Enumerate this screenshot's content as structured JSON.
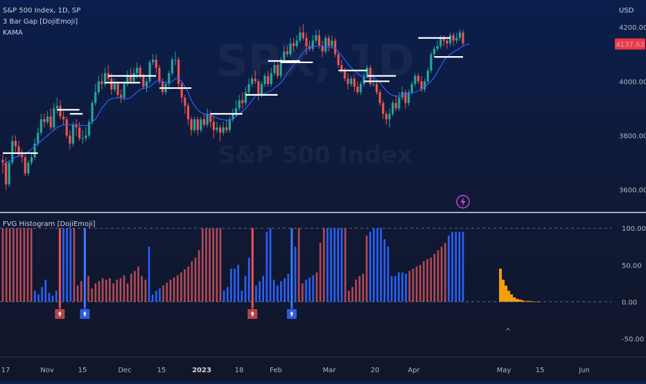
{
  "header": {
    "symbol": "S&P 500 Index, 1D, SP",
    "indicator_1": "3 Bar Gap [DojiEmoji]",
    "indicator_2": "KAMA",
    "lower_title": "FVG Histogram [DojiEmoji]",
    "currency": "USD"
  },
  "watermark": {
    "line1": "SPX, 1D",
    "line2": "S&P 500 Index"
  },
  "colors": {
    "bull": "#26a69a",
    "bear": "#ef5350",
    "kama": "#2962ff",
    "gap_line": "#ffffff",
    "hist_blue": "#2962ff",
    "hist_red": "#b54a55",
    "hist_orange": "#f59e0b",
    "price_label": "#f23645",
    "divider": "#e0e3eb",
    "lightning": "#c04de0"
  },
  "chart_data": [
    {
      "type": "candlestick",
      "title": "S&P 500 Index, 1D, SP",
      "x_ticks": [
        "17",
        "Nov",
        "15",
        "Dec",
        "15",
        "2023",
        "18",
        "Feb",
        "Mar",
        "20",
        "Apr",
        "May",
        "15",
        "Jun"
      ],
      "y_ticks": [
        "4200.00",
        "4000.00",
        "3800.00",
        "3600.00"
      ],
      "ylim": [
        3520,
        4300
      ],
      "last_price": "4137.63",
      "candles": [
        [
          3710,
          3700,
          3730,
          3660
        ],
        [
          3700,
          3620,
          3720,
          3600
        ],
        [
          3620,
          3700,
          3710,
          3610
        ],
        [
          3700,
          3780,
          3800,
          3690
        ],
        [
          3780,
          3760,
          3800,
          3740
        ],
        [
          3760,
          3730,
          3780,
          3720
        ],
        [
          3730,
          3720,
          3750,
          3700
        ],
        [
          3720,
          3660,
          3730,
          3650
        ],
        [
          3660,
          3700,
          3710,
          3650
        ],
        [
          3700,
          3720,
          3740,
          3690
        ],
        [
          3720,
          3770,
          3790,
          3710
        ],
        [
          3770,
          3810,
          3830,
          3760
        ],
        [
          3810,
          3860,
          3880,
          3800
        ],
        [
          3860,
          3850,
          3880,
          3830
        ],
        [
          3850,
          3870,
          3890,
          3840
        ],
        [
          3870,
          3830,
          3900,
          3820
        ],
        [
          3830,
          3900,
          3920,
          3820
        ],
        [
          3900,
          3910,
          3940,
          3880
        ],
        [
          3910,
          3870,
          3930,
          3860
        ],
        [
          3870,
          3860,
          3890,
          3840
        ],
        [
          3860,
          3800,
          3870,
          3790
        ],
        [
          3800,
          3770,
          3820,
          3750
        ],
        [
          3770,
          3840,
          3850,
          3760
        ],
        [
          3840,
          3830,
          3860,
          3800
        ],
        [
          3830,
          3790,
          3850,
          3780
        ],
        [
          3790,
          3790,
          3820,
          3770
        ],
        [
          3790,
          3800,
          3830,
          3780
        ],
        [
          3800,
          3850,
          3860,
          3790
        ],
        [
          3850,
          3920,
          3930,
          3840
        ],
        [
          3920,
          3960,
          3990,
          3910
        ],
        [
          3960,
          4000,
          4020,
          3950
        ],
        [
          4000,
          3990,
          4030,
          3970
        ],
        [
          3990,
          4030,
          4050,
          3980
        ],
        [
          4030,
          4010,
          4060,
          4000
        ],
        [
          4010,
          3970,
          4030,
          3950
        ],
        [
          3970,
          3990,
          4010,
          3960
        ],
        [
          3990,
          3950,
          4000,
          3940
        ],
        [
          3950,
          3940,
          3970,
          3920
        ],
        [
          3940,
          3990,
          4000,
          3930
        ],
        [
          3990,
          4020,
          4040,
          3980
        ],
        [
          4020,
          4000,
          4050,
          3990
        ],
        [
          4000,
          4030,
          4050,
          3990
        ],
        [
          4030,
          4050,
          4070,
          4010
        ],
        [
          4050,
          4020,
          4060,
          4010
        ],
        [
          4020,
          3980,
          4030,
          3970
        ],
        [
          3980,
          4000,
          4010,
          3960
        ],
        [
          4000,
          4070,
          4080,
          3990
        ],
        [
          4070,
          4080,
          4100,
          4060
        ],
        [
          4080,
          4050,
          4100,
          4030
        ],
        [
          4050,
          4000,
          4060,
          3990
        ],
        [
          4000,
          3960,
          4010,
          3950
        ],
        [
          3960,
          3990,
          4000,
          3950
        ],
        [
          3990,
          4030,
          4040,
          3970
        ],
        [
          4030,
          4080,
          4090,
          4020
        ],
        [
          4080,
          4080,
          4110,
          4060
        ],
        [
          4080,
          3990,
          4090,
          3970
        ],
        [
          3990,
          3940,
          4000,
          3920
        ],
        [
          3940,
          3910,
          3950,
          3880
        ],
        [
          3910,
          3860,
          3920,
          3840
        ],
        [
          3860,
          3820,
          3870,
          3800
        ],
        [
          3820,
          3860,
          3870,
          3810
        ],
        [
          3860,
          3820,
          3870,
          3800
        ],
        [
          3820,
          3860,
          3870,
          3810
        ],
        [
          3860,
          3840,
          3880,
          3830
        ],
        [
          3840,
          3880,
          3900,
          3830
        ],
        [
          3880,
          3850,
          3890,
          3830
        ],
        [
          3850,
          3820,
          3870,
          3790
        ],
        [
          3820,
          3830,
          3850,
          3810
        ],
        [
          3830,
          3810,
          3840,
          3780
        ],
        [
          3810,
          3830,
          3850,
          3800
        ],
        [
          3830,
          3820,
          3860,
          3810
        ],
        [
          3820,
          3860,
          3870,
          3810
        ],
        [
          3860,
          3880,
          3900,
          3850
        ],
        [
          3880,
          3900,
          3930,
          3870
        ],
        [
          3900,
          3930,
          3950,
          3890
        ],
        [
          3930,
          3920,
          3960,
          3900
        ],
        [
          3920,
          3960,
          3980,
          3910
        ],
        [
          3960,
          3990,
          4010,
          3950
        ],
        [
          3990,
          4010,
          4020,
          3980
        ],
        [
          4010,
          4000,
          4040,
          3990
        ],
        [
          4000,
          3950,
          4010,
          3930
        ],
        [
          3950,
          3990,
          4000,
          3940
        ],
        [
          3990,
          4020,
          4030,
          3980
        ],
        [
          4020,
          3990,
          4040,
          3980
        ],
        [
          3990,
          4030,
          4050,
          3980
        ],
        [
          4030,
          4060,
          4070,
          4020
        ],
        [
          4060,
          4020,
          4070,
          4010
        ],
        [
          4020,
          4080,
          4090,
          4010
        ],
        [
          4080,
          4110,
          4130,
          4070
        ],
        [
          4110,
          4100,
          4130,
          4090
        ],
        [
          4100,
          4140,
          4160,
          4090
        ],
        [
          4140,
          4130,
          4160,
          4110
        ],
        [
          4130,
          4150,
          4170,
          4120
        ],
        [
          4150,
          4180,
          4200,
          4140
        ],
        [
          4180,
          4160,
          4210,
          4150
        ],
        [
          4160,
          4130,
          4180,
          4100
        ],
        [
          4130,
          4120,
          4150,
          4110
        ],
        [
          4120,
          4150,
          4170,
          4110
        ],
        [
          4150,
          4170,
          4190,
          4140
        ],
        [
          4170,
          4130,
          4190,
          4120
        ],
        [
          4130,
          4110,
          4150,
          4090
        ],
        [
          4110,
          4160,
          4170,
          4100
        ],
        [
          4160,
          4130,
          4170,
          4110
        ],
        [
          4130,
          4150,
          4170,
          4120
        ],
        [
          4150,
          4100,
          4160,
          4090
        ],
        [
          4100,
          4060,
          4110,
          4050
        ],
        [
          4060,
          4040,
          4080,
          4030
        ],
        [
          4040,
          4010,
          4050,
          4000
        ],
        [
          4010,
          3990,
          4030,
          3970
        ],
        [
          3990,
          4010,
          4020,
          3980
        ],
        [
          4010,
          3980,
          4020,
          3960
        ],
        [
          3980,
          3960,
          4000,
          3950
        ],
        [
          3960,
          3990,
          4000,
          3950
        ],
        [
          3990,
          4020,
          4030,
          3980
        ],
        [
          4020,
          4050,
          4060,
          4010
        ],
        [
          4050,
          3990,
          4060,
          3980
        ],
        [
          3990,
          3990,
          4010,
          3980
        ],
        [
          3990,
          3960,
          4000,
          3950
        ],
        [
          3960,
          3920,
          3970,
          3910
        ],
        [
          3920,
          3880,
          3930,
          3860
        ],
        [
          3880,
          3860,
          3890,
          3840
        ],
        [
          3860,
          3880,
          3900,
          3830
        ],
        [
          3880,
          3920,
          3930,
          3870
        ],
        [
          3920,
          3900,
          3950,
          3890
        ],
        [
          3900,
          3940,
          3960,
          3890
        ],
        [
          3940,
          3960,
          3980,
          3930
        ],
        [
          3960,
          3920,
          3970,
          3900
        ],
        [
          3920,
          3960,
          3970,
          3910
        ],
        [
          3960,
          3990,
          4000,
          3950
        ],
        [
          3990,
          4020,
          4030,
          3980
        ],
        [
          4020,
          4000,
          4030,
          3990
        ],
        [
          4000,
          3970,
          4020,
          3960
        ],
        [
          3970,
          4000,
          4010,
          3960
        ],
        [
          4000,
          4040,
          4050,
          3990
        ],
        [
          4040,
          4100,
          4110,
          4030
        ],
        [
          4100,
          4120,
          4130,
          4090
        ],
        [
          4120,
          4130,
          4150,
          4110
        ],
        [
          4130,
          4160,
          4170,
          4120
        ],
        [
          4160,
          4150,
          4170,
          4130
        ],
        [
          4150,
          4140,
          4160,
          4120
        ],
        [
          4140,
          4170,
          4180,
          4130
        ],
        [
          4170,
          4150,
          4180,
          4130
        ],
        [
          4150,
          4160,
          4180,
          4140
        ],
        [
          4160,
          4180,
          4190,
          4150
        ],
        [
          4180,
          4140,
          4190,
          4130
        ]
      ],
      "kama": [
        3690,
        3700,
        3705,
        3710,
        3720,
        3725,
        3730,
        3735,
        3740,
        3750,
        3760,
        3770,
        3780,
        3790,
        3800,
        3810,
        3820,
        3830,
        3835,
        3840,
        3840,
        3840,
        3840,
        3840,
        3838,
        3836,
        3836,
        3840,
        3850,
        3860,
        3880,
        3900,
        3915,
        3930,
        3935,
        3938,
        3940,
        3938,
        3936,
        3935,
        3940,
        3950,
        3960,
        3970,
        3975,
        3975,
        3980,
        3990,
        4000,
        4000,
        3998,
        3995,
        3995,
        4000,
        4010,
        4010,
        4000,
        3980,
        3960,
        3930,
        3910,
        3895,
        3885,
        3880,
        3878,
        3875,
        3870,
        3865,
        3860,
        3858,
        3856,
        3856,
        3860,
        3870,
        3880,
        3890,
        3900,
        3915,
        3930,
        3945,
        3950,
        3950,
        3955,
        3960,
        3965,
        3975,
        3985,
        3995,
        4010,
        4030,
        4045,
        4060,
        4075,
        4090,
        4105,
        4120,
        4125,
        4128,
        4130,
        4132,
        4130,
        4128,
        4126,
        4125,
        4122,
        4110,
        4095,
        4080,
        4065,
        4050,
        4040,
        4030,
        4020,
        4015,
        4015,
        4018,
        4015,
        4005,
        3995,
        3980,
        3965,
        3955,
        3948,
        3945,
        3945,
        3948,
        3952,
        3955,
        3958,
        3960,
        3965,
        3972,
        3980,
        3990,
        4000,
        4015,
        4035,
        4055,
        4075,
        4090,
        4100,
        4108,
        4115,
        4122,
        4130,
        4135,
        4138
      ]
    },
    {
      "type": "bar",
      "title": "FVG Histogram [DojiEmoji]",
      "y_ticks": [
        "100.00",
        "50.00",
        "0.00",
        "-50.00"
      ],
      "ylim": [
        -75,
        120
      ],
      "series": [
        {
          "values": [
            100,
            100,
            100,
            100,
            100,
            100,
            100,
            100,
            100,
            15,
            10,
            20,
            30,
            12,
            8,
            15,
            40,
            100,
            100,
            100,
            100,
            22,
            28,
            48,
            35,
            18,
            25,
            28,
            32,
            30,
            32,
            25,
            30,
            32,
            36,
            25,
            38,
            42,
            48,
            35,
            30,
            75,
            10,
            15,
            18,
            22,
            26,
            30,
            33,
            36,
            40,
            44,
            48,
            55,
            60,
            70,
            100,
            100,
            100,
            100,
            100,
            100,
            15,
            20,
            45,
            45,
            50,
            15,
            35,
            60,
            100,
            22,
            28,
            35,
            95,
            100,
            30,
            22,
            28,
            32,
            38,
            45,
            75,
            100,
            25,
            30,
            33,
            36,
            40,
            80,
            100,
            100,
            100,
            100,
            100,
            100,
            100,
            15,
            20,
            30,
            35,
            38,
            90,
            95,
            100,
            100,
            100,
            85,
            75,
            35,
            35,
            40,
            40,
            38,
            42,
            45,
            48,
            50,
            55,
            58,
            60,
            65,
            70,
            75,
            80,
            90,
            95,
            95,
            95,
            95
          ]
        },
        {
          "values": [
            45,
            30,
            22,
            15,
            10,
            6,
            4,
            3,
            2,
            1,
            1,
            1,
            0,
            0,
            0
          ]
        }
      ],
      "markers": [
        "^"
      ]
    }
  ]
}
